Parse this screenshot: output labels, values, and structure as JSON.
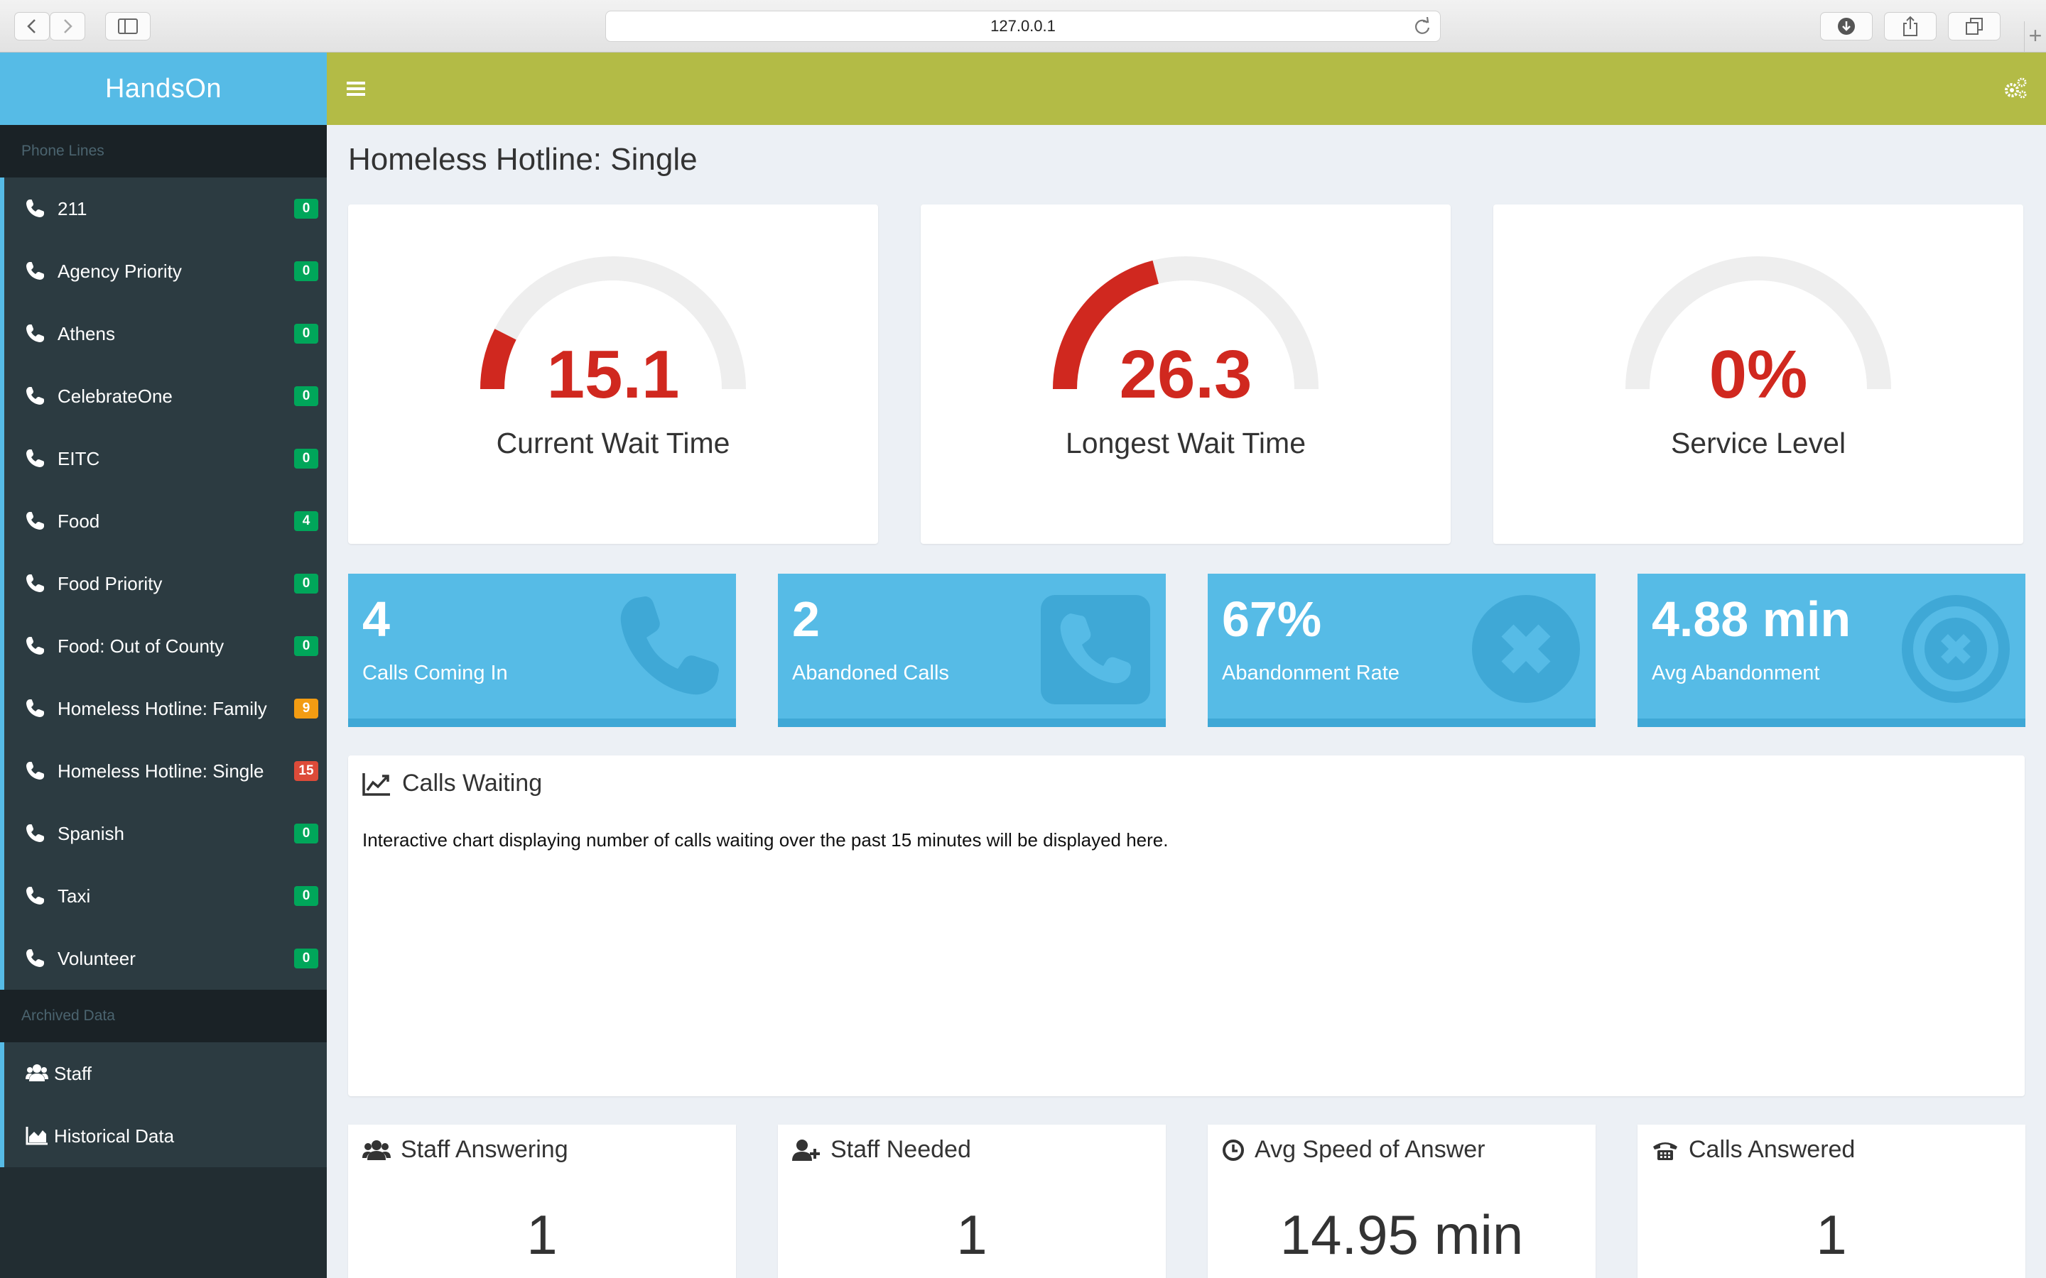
{
  "browser": {
    "url": "127.0.0.1"
  },
  "app": {
    "brand": "HandsOn"
  },
  "sidebar": {
    "phone_lines_header": "Phone Lines",
    "lines": [
      {
        "label": "211",
        "count": "0",
        "badge_color": "#00a65a"
      },
      {
        "label": "Agency Priority",
        "count": "0",
        "badge_color": "#00a65a"
      },
      {
        "label": "Athens",
        "count": "0",
        "badge_color": "#00a65a"
      },
      {
        "label": "CelebrateOne",
        "count": "0",
        "badge_color": "#00a65a"
      },
      {
        "label": "EITC",
        "count": "0",
        "badge_color": "#00a65a"
      },
      {
        "label": "Food",
        "count": "4",
        "badge_color": "#00a65a"
      },
      {
        "label": "Food Priority",
        "count": "0",
        "badge_color": "#00a65a"
      },
      {
        "label": "Food: Out of County",
        "count": "0",
        "badge_color": "#00a65a"
      },
      {
        "label": "Homeless Hotline: Family",
        "count": "9",
        "badge_color": "#f39c12"
      },
      {
        "label": "Homeless Hotline: Single",
        "count": "15",
        "badge_color": "#dd4b39"
      },
      {
        "label": "Spanish",
        "count": "0",
        "badge_color": "#00a65a"
      },
      {
        "label": "Taxi",
        "count": "0",
        "badge_color": "#00a65a"
      },
      {
        "label": "Volunteer",
        "count": "0",
        "badge_color": "#00a65a"
      }
    ],
    "archived_header": "Archived Data",
    "archived": [
      {
        "label": "Staff",
        "icon": "users-icon"
      },
      {
        "label": "Historical Data",
        "icon": "area-chart-icon"
      }
    ]
  },
  "page": {
    "title": "Homeless Hotline: Single"
  },
  "gauges": [
    {
      "value": "15.1",
      "label": "Current Wait Time",
      "fill_fraction": 0.15
    },
    {
      "value": "26.3",
      "label": "Longest Wait Time",
      "fill_fraction": 0.42
    },
    {
      "value": "0%",
      "label": "Service Level",
      "fill_fraction": 0
    }
  ],
  "stats": [
    {
      "value": "4",
      "label": "Calls Coming In",
      "icon": "phone-icon"
    },
    {
      "value": "2",
      "label": "Abandoned Calls",
      "icon": "phone-square-icon"
    },
    {
      "value": "67%",
      "label": "Abandonment Rate",
      "icon": "times-circle-icon"
    },
    {
      "value": "4.88 min",
      "label": "Avg Abandonment",
      "icon": "times-circle-outline-icon"
    }
  ],
  "calls_waiting": {
    "title": "Calls Waiting",
    "text": "Interactive chart displaying number of calls waiting over the past 15 minutes will be displayed here."
  },
  "cards": [
    {
      "title": "Staff Answering",
      "value": "1",
      "icon": "users-icon"
    },
    {
      "title": "Staff Needed",
      "value": "1",
      "icon": "user-plus-icon"
    },
    {
      "title": "Avg Speed of Answer",
      "value": "14.95 min",
      "icon": "clock-icon"
    },
    {
      "title": "Calls Answered",
      "value": "1",
      "icon": "fax-icon"
    }
  ],
  "colors": {
    "brand": "#56bbe6",
    "topbar": "#b3bb46",
    "sidebar": "#222d32",
    "gauge_fill": "#d0281f",
    "gauge_track": "#eeeeee"
  }
}
